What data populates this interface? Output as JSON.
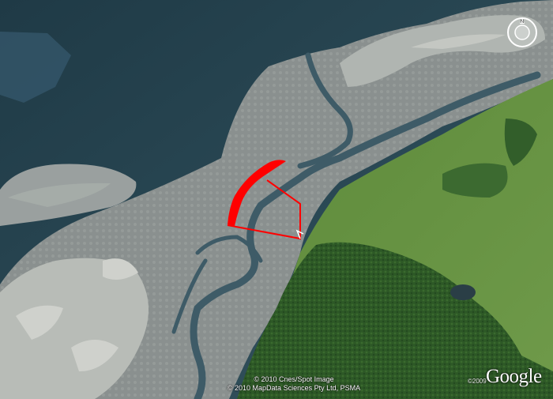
{
  "attribution": {
    "imagery": "© 2010 Cnes/Spot Image",
    "data": "© 2010 MapData Sciences Pty Ltd, PSMA"
  },
  "logo": {
    "year": "©2009",
    "name": "Google"
  },
  "compass": {
    "north_label": "N"
  },
  "colors": {
    "sea": "#24404a",
    "tidal_flats": "#8b9191",
    "channels": "#3e5a66",
    "land_green": "#5e8f3c",
    "forest": "#2e5a26",
    "overlay_route": "#ff0000"
  }
}
